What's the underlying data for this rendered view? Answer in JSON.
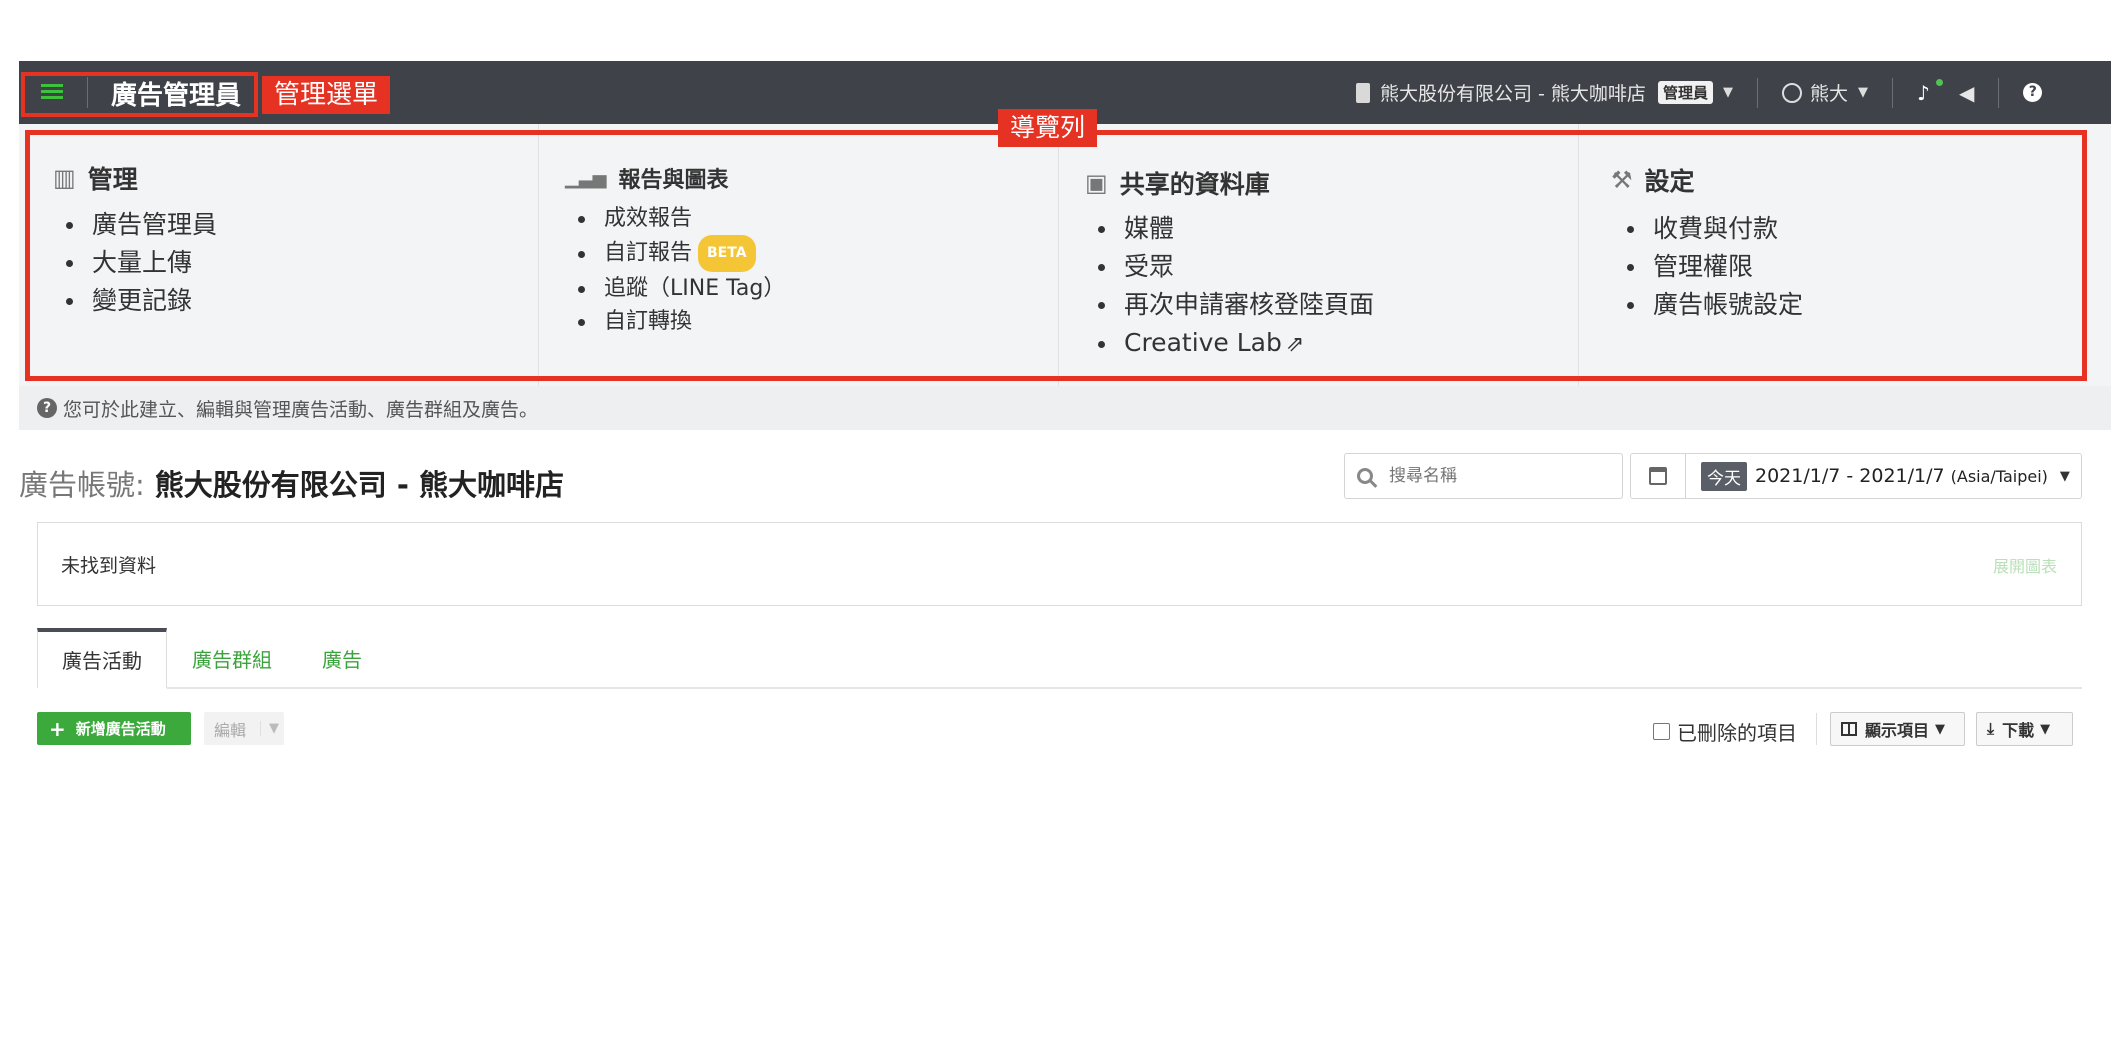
{
  "topbar": {
    "app_title": "廣告管理員",
    "account_name": "熊大股份有限公司 - 熊大咖啡店",
    "role_badge": "管理員",
    "user_name": "熊大"
  },
  "callouts": {
    "menu": "管理選單",
    "nav": "導覽列"
  },
  "nav": {
    "columns": [
      {
        "title": "管理",
        "icon": "bank-icon",
        "items": [
          "廣告管理員",
          "大量上傳",
          "變更記錄"
        ]
      },
      {
        "title": "報告與圖表",
        "icon": "bar-chart-icon",
        "items": [
          "成效報告",
          "自訂報告",
          "追蹤（LINE Tag）",
          "自訂轉換"
        ],
        "beta_label": "BETA"
      },
      {
        "title": "共享的資料庫",
        "icon": "image-icon",
        "items": [
          "媒體",
          "受眾",
          "再次申請審核登陸頁面",
          "Creative Lab"
        ]
      },
      {
        "title": "設定",
        "icon": "wrench-icon",
        "items": [
          "收費與付款",
          "管理權限",
          "廣告帳號設定"
        ]
      }
    ]
  },
  "info_text": "您可於此建立、編輯與管理廣告活動、廣告群組及廣告。",
  "account": {
    "label": "廣告帳號:",
    "name": "熊大股份有限公司 - 熊大咖啡店"
  },
  "search": {
    "placeholder": "搜尋名稱"
  },
  "date": {
    "today_label": "今天",
    "range": "2021/1/7 - 2021/1/7",
    "timezone": "(Asia/Taipei)"
  },
  "empty": {
    "message": "未找到資料",
    "expand_label": "展開圖表"
  },
  "tabs": [
    "廣告活動",
    "廣告群組",
    "廣告"
  ],
  "toolbar": {
    "add_label": "新增廣告活動",
    "edit_label": "編輯",
    "deleted_label": "已刪除的項目",
    "columns_label": "顯示項目",
    "download_label": "下載"
  },
  "colors": {
    "topbar": "#3f4249",
    "accent_green": "#3ba93b",
    "highlight_red": "#e53223",
    "beta_yellow": "#f4c534"
  }
}
